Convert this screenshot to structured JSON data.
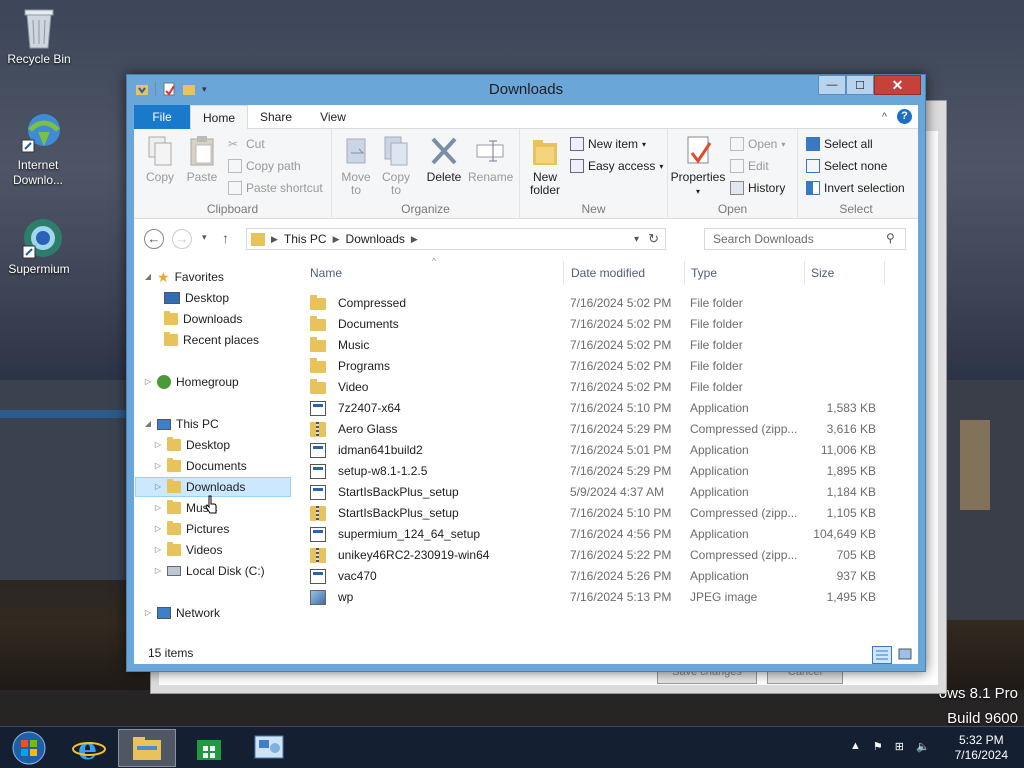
{
  "desktop": {
    "icons": [
      {
        "label": "Recycle Bin"
      },
      {
        "label": "Internet Downlo..."
      },
      {
        "label": "Supermium"
      }
    ],
    "watermark_line1": "ows 8.1 Pro",
    "watermark_line2": "Build 9600"
  },
  "background_window": {
    "save_label": "Save changes",
    "cancel_label": "Cancel"
  },
  "window": {
    "title": "Downloads",
    "caption": {
      "minimize": "—",
      "maximize": "☐",
      "close": "✕"
    }
  },
  "ribbon": {
    "tabs": [
      "File",
      "Home",
      "Share",
      "View"
    ],
    "clipboard": {
      "label": "Clipboard",
      "copy": "Copy",
      "paste": "Paste",
      "cut": "Cut",
      "copy_path": "Copy path",
      "paste_shortcut": "Paste shortcut"
    },
    "organize": {
      "label": "Organize",
      "move_to": "Move to",
      "copy_to": "Copy to",
      "delete": "Delete",
      "rename": "Rename"
    },
    "new": {
      "label": "New",
      "new_folder": "New folder",
      "new_item": "New item",
      "easy_access": "Easy access"
    },
    "open": {
      "label": "Open",
      "properties": "Properties",
      "open": "Open",
      "edit": "Edit",
      "history": "History"
    },
    "select": {
      "label": "Select",
      "select_all": "Select all",
      "select_none": "Select none",
      "invert": "Invert selection"
    }
  },
  "address": {
    "crumb1": "This PC",
    "crumb2": "Downloads",
    "search_placeholder": "Search Downloads"
  },
  "nav": {
    "favorites": "Favorites",
    "fav_desktop": "Desktop",
    "fav_downloads": "Downloads",
    "fav_recent": "Recent places",
    "homegroup": "Homegroup",
    "thispc": "This PC",
    "pc_desktop": "Desktop",
    "pc_documents": "Documents",
    "pc_downloads": "Downloads",
    "pc_music": "Music",
    "pc_pictures": "Pictures",
    "pc_videos": "Videos",
    "pc_local": "Local Disk (C:)",
    "network": "Network"
  },
  "columns": {
    "name": "Name",
    "date": "Date modified",
    "type": "Type",
    "size": "Size"
  },
  "files": [
    {
      "name": "Compressed",
      "date": "7/16/2024 5:02 PM",
      "type": "File folder",
      "size": "",
      "kind": "folder"
    },
    {
      "name": "Documents",
      "date": "7/16/2024 5:02 PM",
      "type": "File folder",
      "size": "",
      "kind": "folder"
    },
    {
      "name": "Music",
      "date": "7/16/2024 5:02 PM",
      "type": "File folder",
      "size": "",
      "kind": "folder"
    },
    {
      "name": "Programs",
      "date": "7/16/2024 5:02 PM",
      "type": "File folder",
      "size": "",
      "kind": "folder"
    },
    {
      "name": "Video",
      "date": "7/16/2024 5:02 PM",
      "type": "File folder",
      "size": "",
      "kind": "folder"
    },
    {
      "name": "7z2407-x64",
      "date": "7/16/2024 5:10 PM",
      "type": "Application",
      "size": "1,583 KB",
      "kind": "app"
    },
    {
      "name": "Aero Glass",
      "date": "7/16/2024 5:29 PM",
      "type": "Compressed (zipp...",
      "size": "3,616 KB",
      "kind": "zip"
    },
    {
      "name": "idman641build2",
      "date": "7/16/2024 5:01 PM",
      "type": "Application",
      "size": "11,006 KB",
      "kind": "app"
    },
    {
      "name": "setup-w8.1-1.2.5",
      "date": "7/16/2024 5:29 PM",
      "type": "Application",
      "size": "1,895 KB",
      "kind": "app"
    },
    {
      "name": "StartIsBackPlus_setup",
      "date": "5/9/2024 4:37 AM",
      "type": "Application",
      "size": "1,184 KB",
      "kind": "app"
    },
    {
      "name": "StartIsBackPlus_setup",
      "date": "7/16/2024 5:10 PM",
      "type": "Compressed (zipp...",
      "size": "1,105 KB",
      "kind": "zip"
    },
    {
      "name": "supermium_124_64_setup",
      "date": "7/16/2024 4:56 PM",
      "type": "Application",
      "size": "104,649 KB",
      "kind": "app"
    },
    {
      "name": "unikey46RC2-230919-win64",
      "date": "7/16/2024 5:22 PM",
      "type": "Compressed (zipp...",
      "size": "705 KB",
      "kind": "zip"
    },
    {
      "name": "vac470",
      "date": "7/16/2024 5:26 PM",
      "type": "Application",
      "size": "937 KB",
      "kind": "app"
    },
    {
      "name": "wp",
      "date": "7/16/2024 5:13 PM",
      "type": "JPEG image",
      "size": "1,495 KB",
      "kind": "img"
    }
  ],
  "status": {
    "count": "15 items"
  },
  "taskbar": {
    "time": "5:32 PM",
    "date": "7/16/2024"
  }
}
